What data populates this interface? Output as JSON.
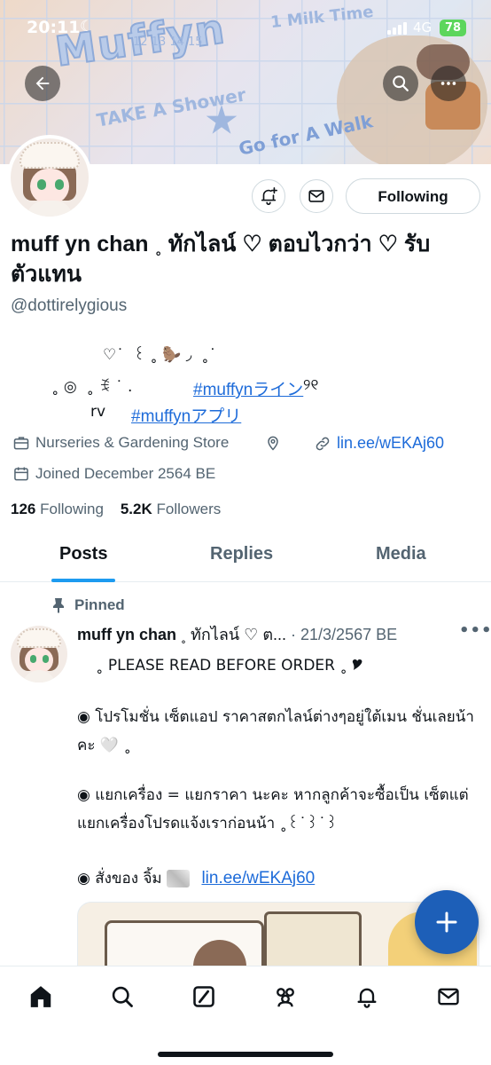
{
  "status_bar": {
    "time": "20:11",
    "network": "4G",
    "battery": "78"
  },
  "banner": {
    "title": "Muffyn",
    "milk_text": "1 Milk Time",
    "shower_text": "TAKE A Shower",
    "walk_text": "Go for A Walk",
    "numbers": "12   13   14   15"
  },
  "profile": {
    "name": "muff yn chan ˳ ทักไลน์ ♡ ตอบไวกว่า ♡ รับตัวแทน",
    "handle": "@dottirelygious",
    "bio_line1": "♡˙  ꒰ ˳ 🦫 ◞  ˳˙",
    "bio_line2": "˳ ◎  ˳ ꉂ ˙ .",
    "bio_tag1": "#muffynライン",
    "bio_tag1_tail": "୨୧",
    "bio_line3": "rv",
    "bio_tag2": "#muffynアプリ",
    "category": "Nurseries & Gardening Store",
    "link": "lin.ee/wEKAj60",
    "joined": "Joined December 2564 BE",
    "following_count": "126",
    "following_label": "Following",
    "followers_count": "5.2K",
    "followers_label": "Followers",
    "follow_button": "Following"
  },
  "tabs": [
    {
      "label": "Posts",
      "active": true
    },
    {
      "label": "Replies",
      "active": false
    },
    {
      "label": "Media",
      "active": false
    }
  ],
  "post": {
    "pinned_label": "Pinned",
    "author": "muff yn chan",
    "author_suffix": "˳ ทักไลน์ ♡ ต...",
    "date": "· 21/3/2567 BE",
    "line1": "˳ PLEASE READ BEFORE ORDER ˳ 🎔",
    "para2": "◉ โปรโมชั่น เซ็ตแอป ราคาสตกไลน์ต่างๆอยู่ใต้เมน ชั่นเลยน้าคะ 🤍 ˳",
    "para3": "◉ แยกเครื่อง = แยกราคา นะคะ หากลูกค้าจะซื้อเป็น เซ็ตแต่แยกเครื่องโปรดแจ้งเราก่อนน้า ˳꒰˙꒱˙꒱",
    "para4_prefix": "◉ สั่งของ จิ้ม",
    "para4_link": "lin.ee/wEKAj60"
  },
  "icons": {
    "back": "arrow-left-icon",
    "search": "search-icon",
    "more": "more-horizontal-icon",
    "notify": "bell-plus-icon",
    "message": "envelope-icon",
    "category": "briefcase-icon",
    "location": "location-pin-icon",
    "link": "link-icon",
    "calendar": "calendar-icon",
    "pin": "pin-icon",
    "compose": "plus-icon",
    "nav": [
      "home-icon",
      "search-icon",
      "grok-icon",
      "communities-icon",
      "bell-icon",
      "envelope-icon"
    ]
  },
  "colors": {
    "accent": "#1d9bf0",
    "link": "#1d6bd9",
    "fab": "#1d5fb8",
    "secondary_text": "#536471"
  }
}
